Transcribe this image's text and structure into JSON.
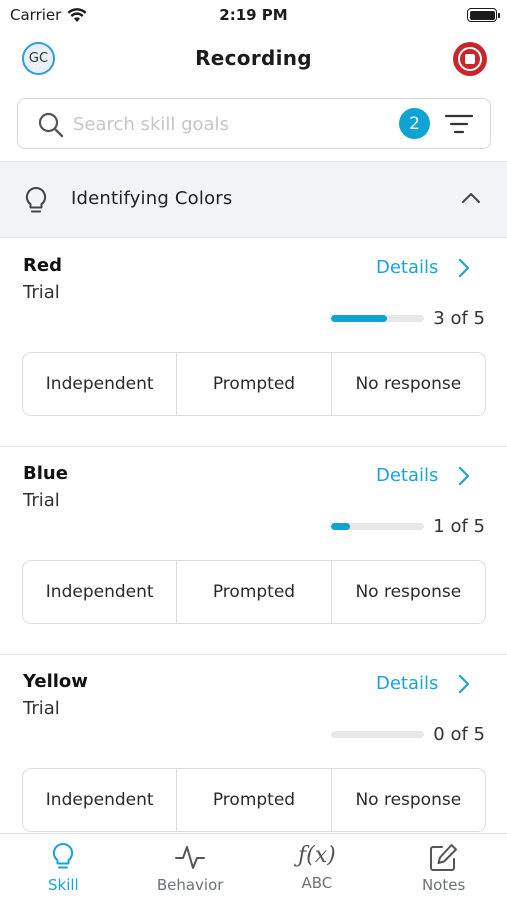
{
  "status_bar": {
    "carrier": "Carrier",
    "time": "2:19 PM"
  },
  "nav": {
    "avatar_initials": "GC",
    "title": "Recording"
  },
  "search": {
    "placeholder": "Search skill goals",
    "value": "",
    "filter_count": "2"
  },
  "section": {
    "title": "Identifying Colors",
    "expanded": true
  },
  "skills": [
    {
      "name": "Red",
      "type": "Trial",
      "details_label": "Details",
      "progress_fraction": 0.6,
      "progress_text": "3 of 5",
      "options": [
        "Independent",
        "Prompted",
        "No response"
      ]
    },
    {
      "name": "Blue",
      "type": "Trial",
      "details_label": "Details",
      "progress_fraction": 0.2,
      "progress_text": "1 of 5",
      "options": [
        "Independent",
        "Prompted",
        "No response"
      ]
    },
    {
      "name": "Yellow",
      "type": "Trial",
      "details_label": "Details",
      "progress_fraction": 0.0,
      "progress_text": "0 of 5",
      "options": [
        "Independent",
        "Prompted",
        "No response"
      ]
    }
  ],
  "tabs": [
    {
      "label": "Skill",
      "icon": "lightbulb-icon",
      "active": true
    },
    {
      "label": "Behavior",
      "icon": "pulse-icon",
      "active": false
    },
    {
      "label": "ABC",
      "icon": "function-icon",
      "active": false
    },
    {
      "label": "Notes",
      "icon": "edit-note-icon",
      "active": false
    }
  ],
  "colors": {
    "accent": "#1aa3d6",
    "stop": "#c9262b",
    "track": "#e6e8eb"
  }
}
